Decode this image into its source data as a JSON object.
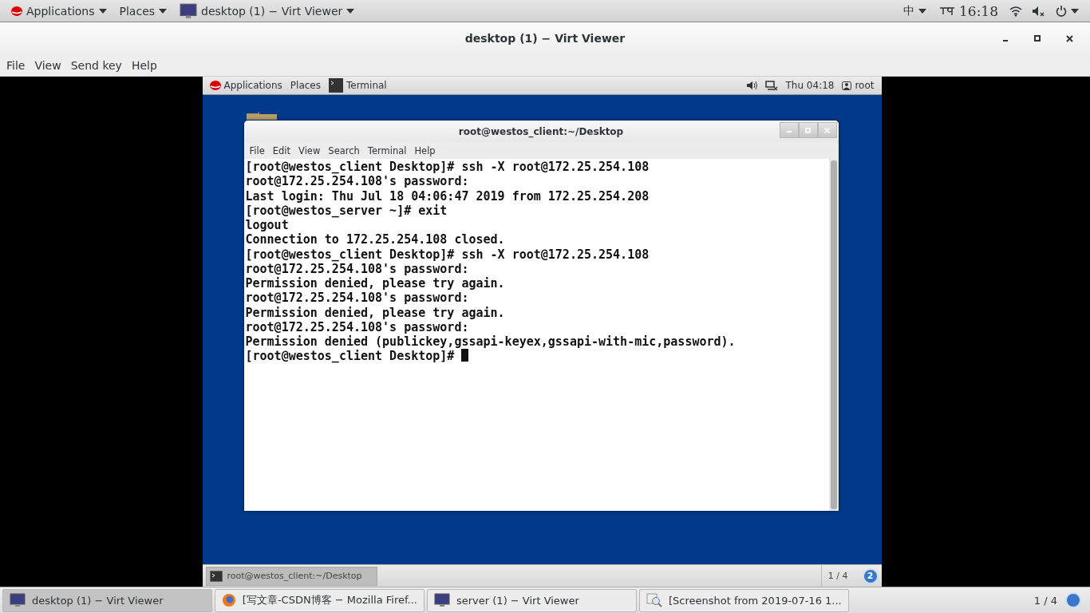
{
  "top_bar": {
    "applications": "Applications",
    "places": "Places",
    "window_menu": "desktop (1) − Virt Viewer",
    "input_method": "中",
    "clock": "16:18"
  },
  "window": {
    "title": "desktop (1) − Virt Viewer",
    "menu": [
      "File",
      "View",
      "Send key",
      "Help"
    ]
  },
  "guest": {
    "top_bar": {
      "applications": "Applications",
      "places": "Places",
      "app": "Terminal",
      "clock": "Thu 04:18",
      "user": "root"
    },
    "terminal": {
      "title": "root@westos_client:~/Desktop",
      "menu": [
        "File",
        "Edit",
        "View",
        "Search",
        "Terminal",
        "Help"
      ],
      "lines": [
        "[root@westos_client Desktop]# ssh -X root@172.25.254.108",
        "root@172.25.254.108's password: ",
        "Last login: Thu Jul 18 04:06:47 2019 from 172.25.254.208",
        "[root@westos_server ~]# exit",
        "logout",
        "Connection to 172.25.254.108 closed.",
        "[root@westos_client Desktop]# ssh -X root@172.25.254.108",
        "root@172.25.254.108's password: ",
        "Permission denied, please try again.",
        "root@172.25.254.108's password: ",
        "Permission denied, please try again.",
        "root@172.25.254.108's password: ",
        "Permission denied (publickey,gssapi-keyex,gssapi-with-mic,password).",
        "[root@westos_client Desktop]# "
      ]
    },
    "bottom_bar": {
      "task": "root@westos_client:~/Desktop",
      "workspace": "1 / 4",
      "badge": "2"
    }
  },
  "taskbar": {
    "tasks": [
      {
        "label": "desktop (1) − Virt Viewer",
        "kind": "monitor",
        "selected": true
      },
      {
        "label": "[写文章-CSDN博客 − Mozilla Firef...",
        "kind": "browser",
        "selected": false
      },
      {
        "label": "server (1) − Virt Viewer",
        "kind": "monitor",
        "selected": false
      },
      {
        "label": "[Screenshot from 2019-07-16 1...",
        "kind": "viewer",
        "selected": false
      }
    ],
    "workspace": "1 / 4"
  }
}
